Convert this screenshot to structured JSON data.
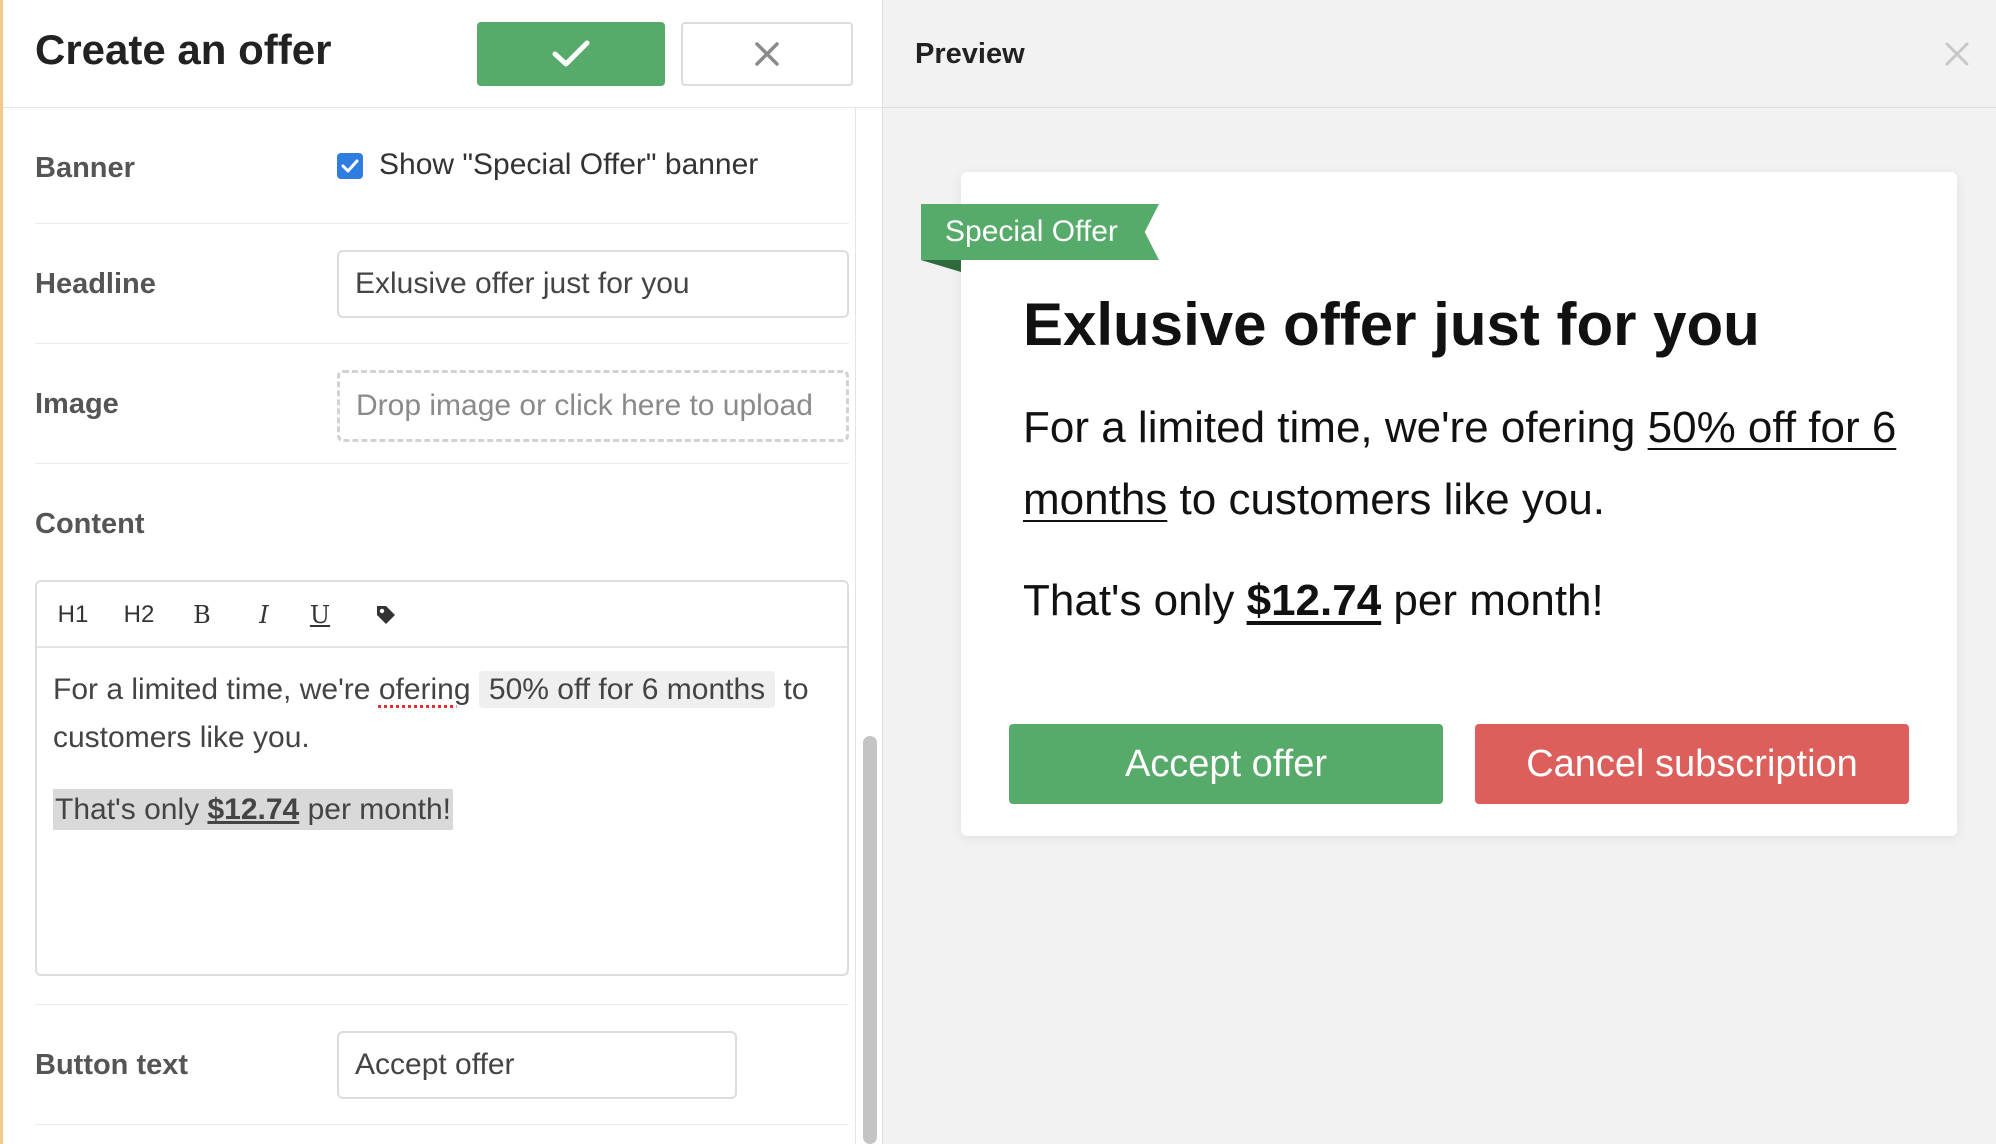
{
  "editor": {
    "title": "Create an offer",
    "banner": {
      "label": "Banner",
      "checkbox_label": "Show \"Special Offer\" banner",
      "checked": true
    },
    "headline": {
      "label": "Headline",
      "value": "Exlusive offer just for you"
    },
    "image": {
      "label": "Image",
      "placeholder": "Drop image or click here to upload"
    },
    "content": {
      "label": "Content",
      "toolbar": {
        "h1": "H1",
        "h2": "H2",
        "bold": "B",
        "italic": "I",
        "underline": "U",
        "tag_icon": "tag-icon"
      },
      "para1_before": "For a limited time, we're ",
      "para1_misspelled": "ofering",
      "para1_tag": "50% off for 6 months",
      "para1_after": " to customers like you.",
      "para2_before": "That's only ",
      "para2_price": "$12.74",
      "para2_after": " per month!"
    },
    "button_text": {
      "label": "Button text",
      "value": "Accept offer"
    }
  },
  "preview": {
    "title": "Preview",
    "ribbon": "Special Offer",
    "headline": "Exlusive offer just for you",
    "text_before": "For a limited time, we're ofering ",
    "text_link": "50% off for 6 months",
    "text_after": " to customers like you.",
    "text2_before": "That's only ",
    "text2_price": "$12.74",
    "text2_after": " per month!",
    "accept_label": "Accept offer",
    "cancel_label": "Cancel subscription"
  },
  "colors": {
    "green": "#57ab6a",
    "red": "#dc5f5b",
    "checkbox_blue": "#2f7de1"
  }
}
